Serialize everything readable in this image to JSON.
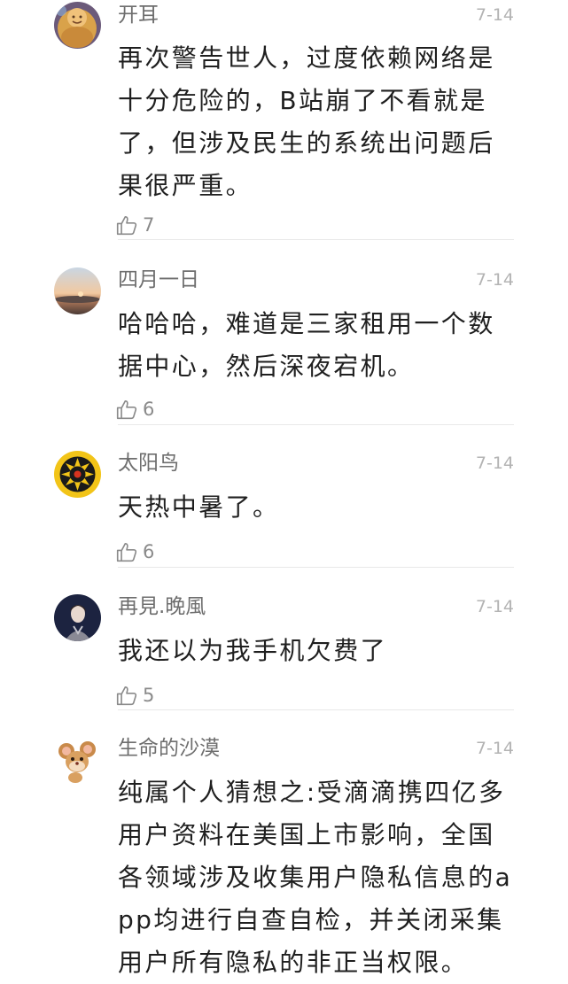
{
  "comments": [
    {
      "username": "开耳",
      "date": "7-14",
      "text": "再次警告世人，过度依赖网络是十分危险的，B站崩了不看就是了，但涉及民生的系统出问题后果很严重。",
      "likes": "7",
      "avatar_icon": "buddha-avatar-icon"
    },
    {
      "username": "四月一日",
      "date": "7-14",
      "text": "哈哈哈，难道是三家租用一个数据中心，然后深夜宕机。",
      "likes": "6",
      "avatar_icon": "sunset-avatar-icon"
    },
    {
      "username": "太阳鸟",
      "date": "7-14",
      "text": "天热中暑了。",
      "likes": "6",
      "avatar_icon": "sunbird-avatar-icon"
    },
    {
      "username": "再見.晚風",
      "date": "7-14",
      "text": "我还以为我手机欠费了",
      "likes": "5",
      "avatar_icon": "portrait-avatar-icon"
    },
    {
      "username": "生命的沙漠",
      "date": "7-14",
      "text": "纯属个人猜想之:受滴滴携四亿多用户资料在美国上市影响，全国各领域涉及收集用户隐私信息的app均进行自查自检，并关闭采集用户所有隐私的非正当权限。",
      "likes": "",
      "avatar_icon": "cartoon-mouse-avatar-icon"
    }
  ],
  "colors": {
    "username": "#6e6e6e",
    "date": "#b3b3b3",
    "text": "#1f1f1f",
    "like": "#8a8a8a",
    "divider": "#e9e9e9"
  }
}
